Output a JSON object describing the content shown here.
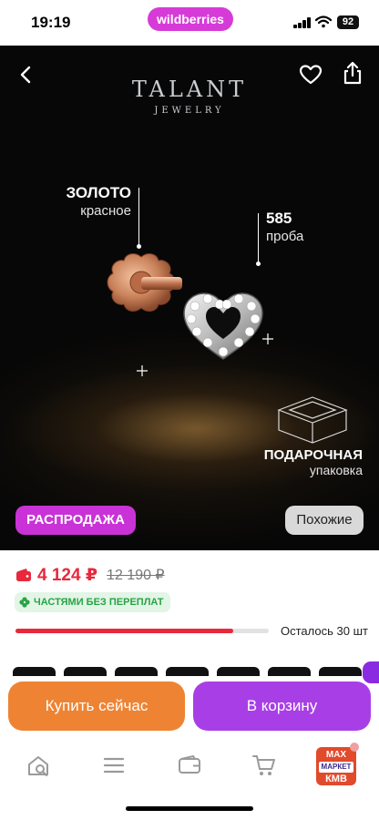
{
  "status_bar": {
    "time": "19:19",
    "url": "wildberries",
    "battery": "92"
  },
  "hero": {
    "brand_name": "TALANT",
    "brand_sub": "JEWELRY",
    "metal": {
      "title": "ЗОЛОТО",
      "subtitle": "красное"
    },
    "probe": {
      "title": "585",
      "subtitle": "проба"
    },
    "gift": {
      "title": "ПОДАРОЧНАЯ",
      "subtitle": "упаковка"
    },
    "sale_badge": "РАСПРОДАЖА",
    "similar_button": "Похожие",
    "icons": {
      "back": "chevron-left-icon",
      "favorite": "heart-icon",
      "share": "share-icon"
    }
  },
  "price": {
    "current": "4 124 ₽",
    "old": "12 190 ₽",
    "installment": "ЧАСТЯМИ БЕЗ ПЕРЕПЛАТ",
    "stock_fill_fraction": 0.86,
    "stock_left": "Осталось 30 шт"
  },
  "actions": {
    "buy_now": "Купить сейчас",
    "add_to_cart": "В корзину"
  },
  "tab_bar": {
    "items": [
      "home-search-icon",
      "catalog-menu-icon",
      "wallet-icon",
      "cart-icon"
    ],
    "promo": {
      "top": "MAX",
      "mid": "МАРКЕТ",
      "bot": "КМВ"
    }
  },
  "colors": {
    "accent": "#a83fe6",
    "sale": "#c932d6",
    "price": "#e8283d",
    "buy_now": "#ee8433",
    "installment_green": "#25a545"
  }
}
